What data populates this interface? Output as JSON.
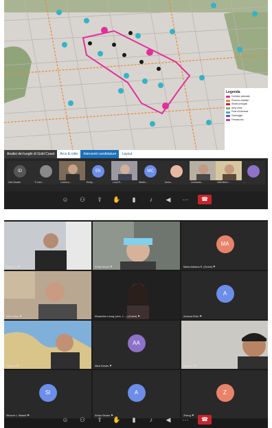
{
  "colors": {
    "accent": "#1c6fb8",
    "hangup": "#c4262e",
    "route": "#e0309a",
    "avatar_blue": "#6c8ee8",
    "avatar_purple": "#8d72c8",
    "avatar_orange": "#e8836a"
  },
  "top": {
    "tabs": [
      "Analisi dei luoghi di Gold Coast",
      "Arcs & rotte",
      "Interventi candidature",
      "Layout"
    ],
    "legend": {
      "title": "Legenda",
      "items": [
        "Corridoio pedonale",
        "Percorso ciclabile",
        "Strade principali",
        "Area verde",
        "Punti di interesse",
        "Parcheggio",
        "Fermata bus"
      ]
    },
    "participants": [
      {
        "name": "Inês Duarte",
        "initials": "ID"
      },
      {
        "name": "Ti Cam...",
        "initials": ""
      },
      {
        "name": "Lorenzo...",
        "initials": ""
      },
      {
        "name": "Emily...",
        "initials": "EK"
      },
      {
        "name": "Luca R...",
        "initials": ""
      },
      {
        "name": "Martin...",
        "initials": "MC"
      },
      {
        "name": "Anna...",
        "initials": ""
      },
      {
        "name": "Leonardo...",
        "initials": ""
      },
      {
        "name": "Valentina L...",
        "initials": ""
      },
      {
        "name": "...",
        "initials": ""
      }
    ]
  },
  "grid": {
    "cells": [
      {
        "name": "Martin C. ⚑",
        "initials": ""
      },
      {
        "name": "Emily Brown ⚑",
        "initials": ""
      },
      {
        "name": "Maria Adriana R. (Guest) ⚑",
        "initials": "MA"
      },
      {
        "name": "Mario Blau ⚑",
        "initials": ""
      },
      {
        "name": "Elisabetta Leong (vers. 1 ...) (Guest) ⚑",
        "initials": ""
      },
      {
        "name": "Arianna Elvio ⚑",
        "initials": "A"
      },
      {
        "name": "Peter B. ⚑",
        "initials": ""
      },
      {
        "name": "Alice Buraw ⚑",
        "initials": "AA"
      },
      {
        "name": "Arturo T. ⚑",
        "initials": ""
      },
      {
        "name": "Simone L. Blasell ⚑",
        "initials": "SI"
      },
      {
        "name": "Arthur Brown ⚑",
        "initials": "A"
      },
      {
        "name": "Zheng ⚑",
        "initials": "Z"
      }
    ]
  }
}
